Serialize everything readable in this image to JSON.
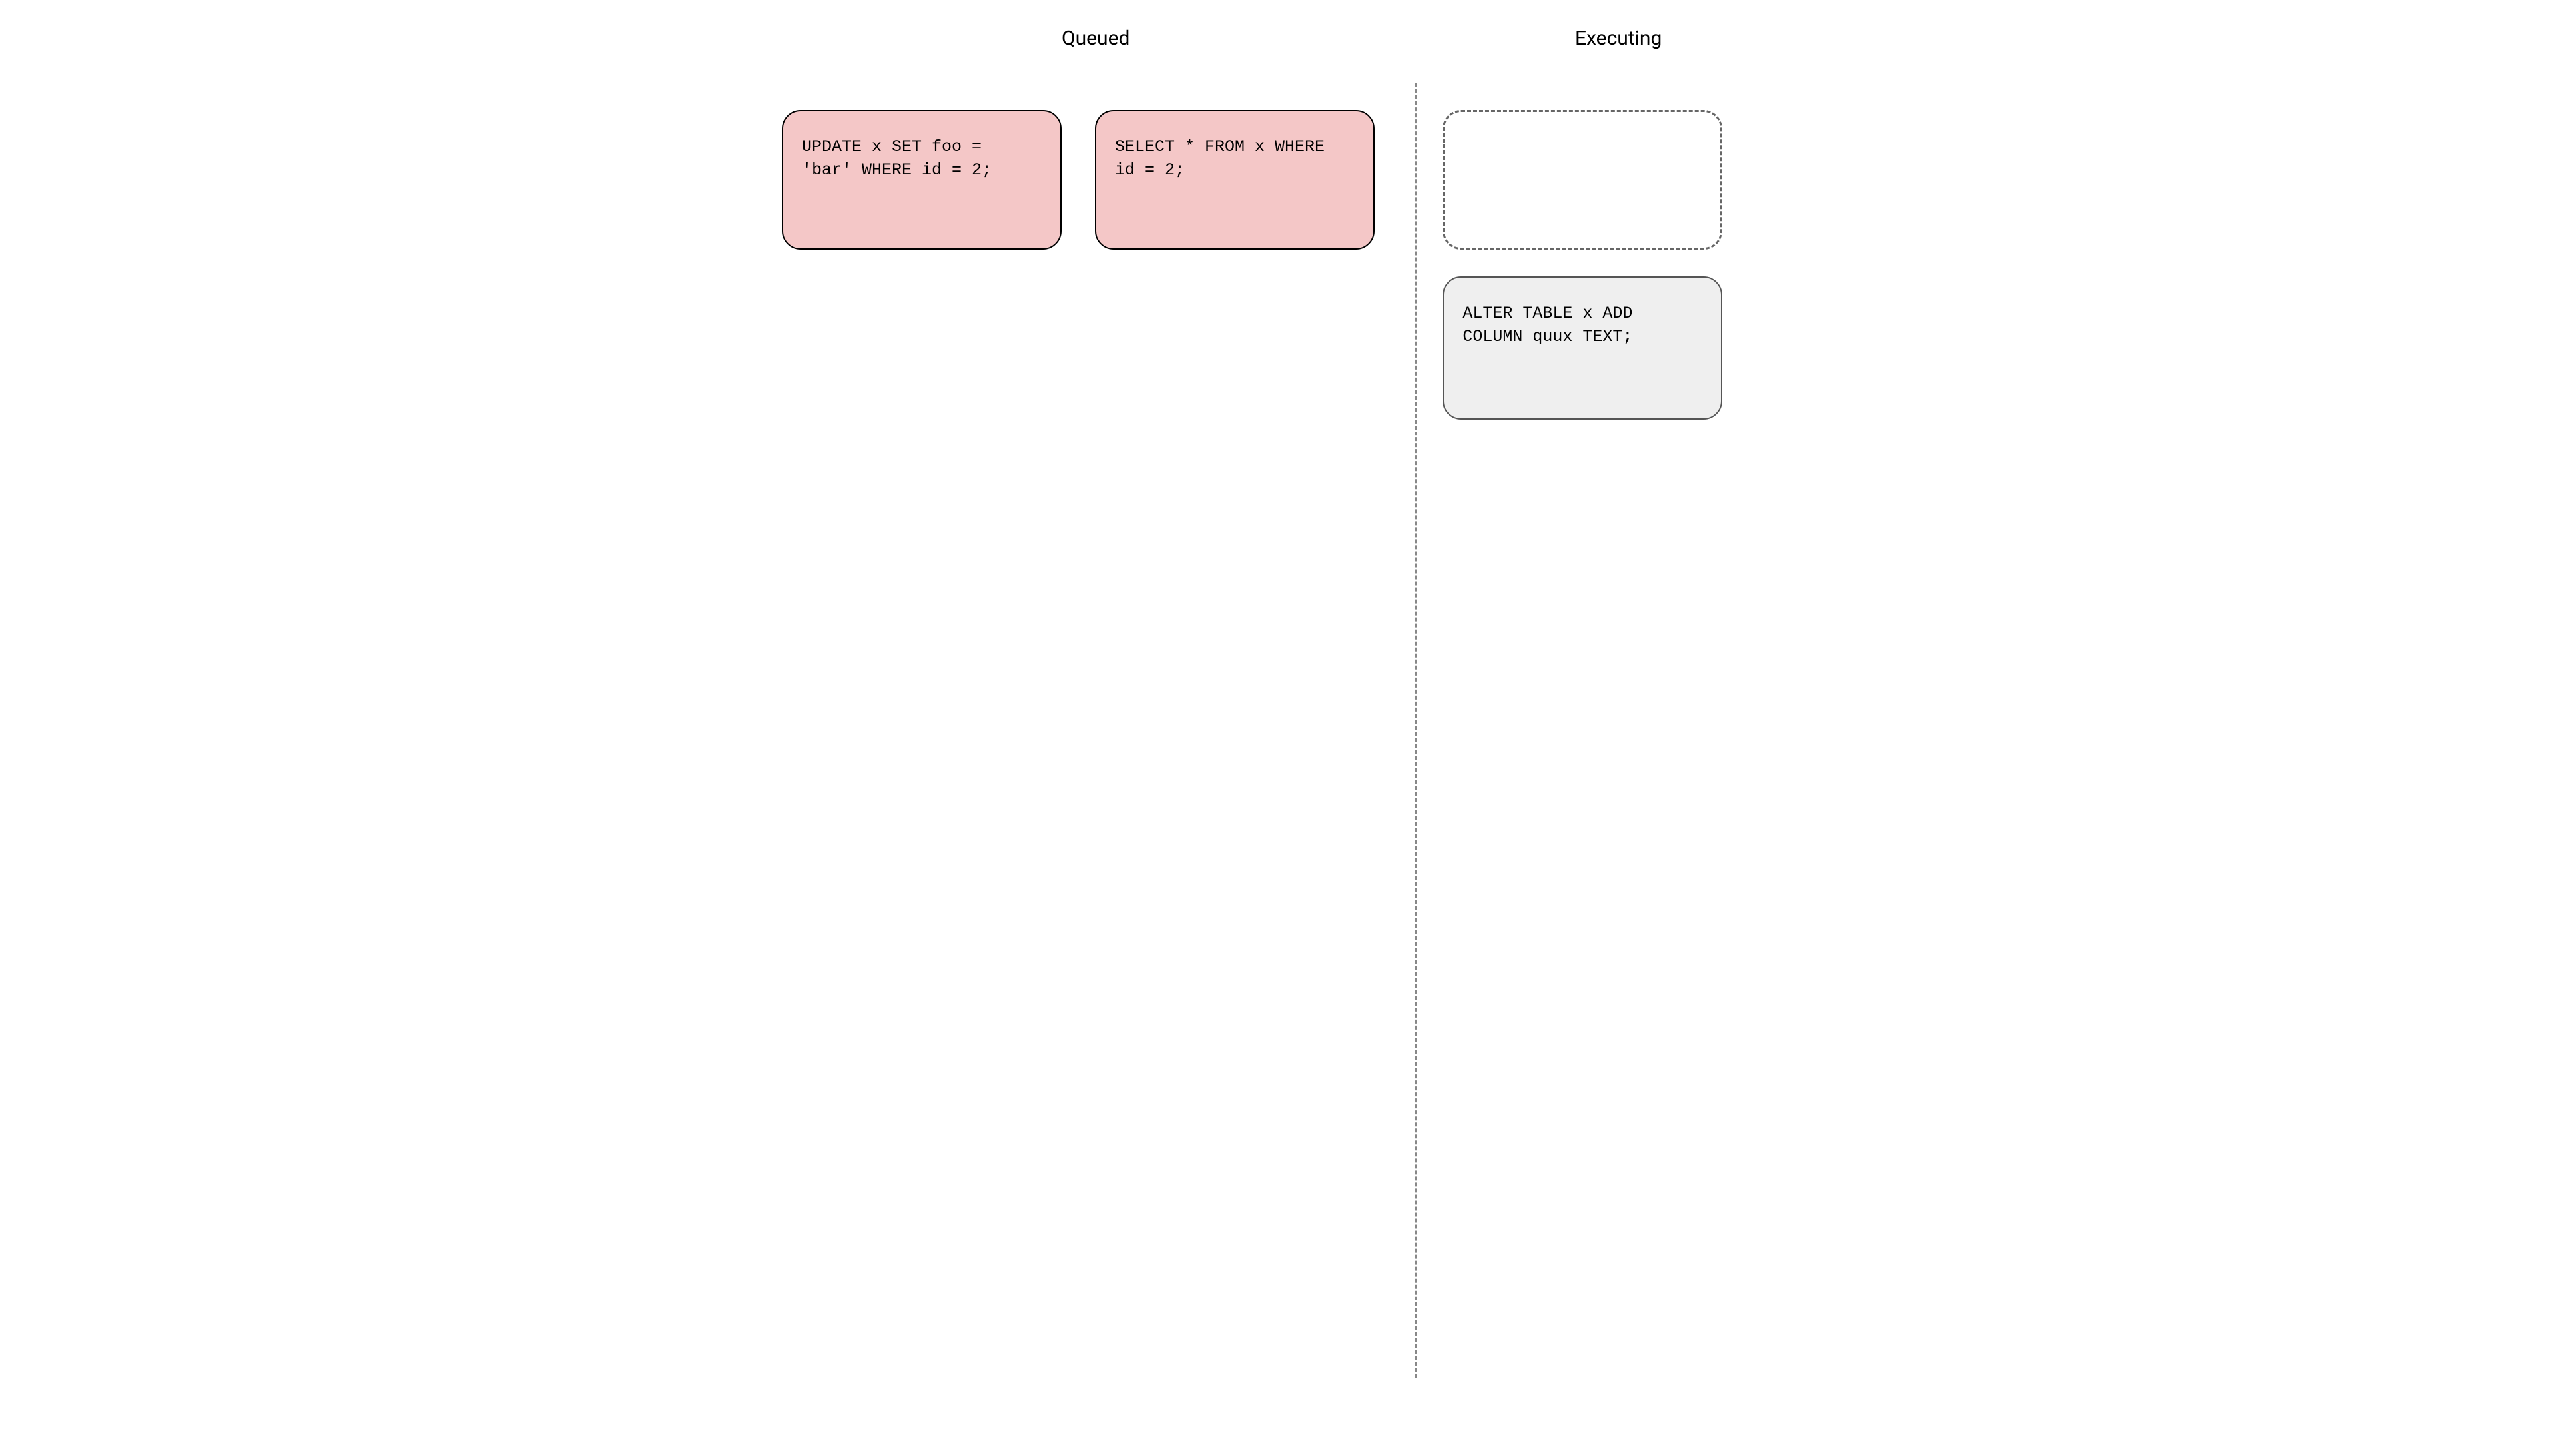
{
  "headers": {
    "queued": "Queued",
    "executing": "Executing"
  },
  "queued_cards": [
    {
      "sql": "UPDATE x SET foo = 'bar' WHERE id = 2;"
    },
    {
      "sql": "SELECT * FROM x WHERE id = 2;"
    }
  ],
  "executing_cards": [
    {
      "type": "empty",
      "sql": ""
    },
    {
      "type": "filled",
      "sql": "ALTER TABLE x ADD COLUMN quux TEXT;"
    }
  ]
}
